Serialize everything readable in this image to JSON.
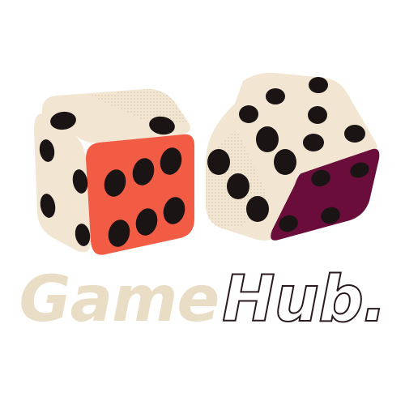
{
  "brand": {
    "word_primary": "Game",
    "word_secondary": "Hub."
  },
  "colors": {
    "die_face": "#f2e6d3",
    "die_shadow": "#e4d3b8",
    "pip": "#1a1414",
    "left_die_side": "#f25c44",
    "right_die_side": "#6a0d3a",
    "wordmark_fill": "#eaddc6",
    "wordmark_outline": "#2a1a1e"
  },
  "icons": [
    "left-die-icon",
    "right-die-icon"
  ]
}
